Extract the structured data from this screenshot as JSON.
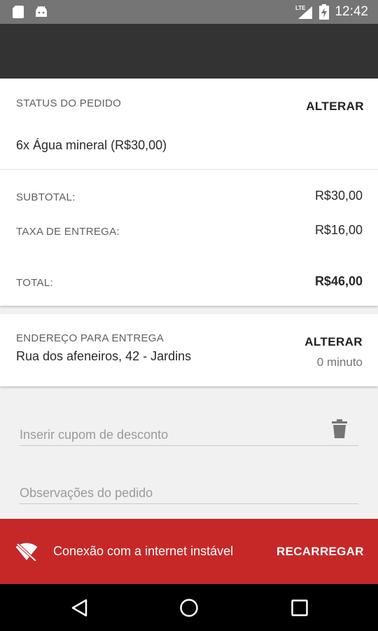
{
  "status_bar": {
    "time": "12:42",
    "network": "LTE"
  },
  "order": {
    "status_label": "STATUS DO PEDIDO",
    "change_label": "ALTERAR",
    "item": "6x Água mineral (R$30,00)",
    "subtotal_label": "SUBTOTAL:",
    "subtotal_value": "R$30,00",
    "fee_label": "TAXA DE ENTREGA:",
    "fee_value": "R$16,00",
    "total_label": "TOTAL:",
    "total_value": "R$46,00"
  },
  "delivery": {
    "address_label": "ENDEREÇO PARA ENTREGA",
    "address": "Rua dos afeneiros, 42 - Jardins",
    "change_label": "ALTERAR",
    "eta": "0 minuto"
  },
  "form": {
    "coupon_placeholder": "Inserir cupom de desconto",
    "notes_placeholder": "Observações do pedido"
  },
  "snackbar": {
    "message": "Conexão com a internet instável",
    "action": "RECARREGAR"
  },
  "colors": {
    "snackbar_bg": "#c62828",
    "toolbar_bg": "#333333",
    "status_bar_bg": "#757575"
  },
  "icons": {
    "wifi_off": "wifi-off-icon",
    "delete": "trash-icon",
    "back": "nav-back-icon",
    "home": "nav-home-icon",
    "recents": "nav-recents-icon"
  }
}
